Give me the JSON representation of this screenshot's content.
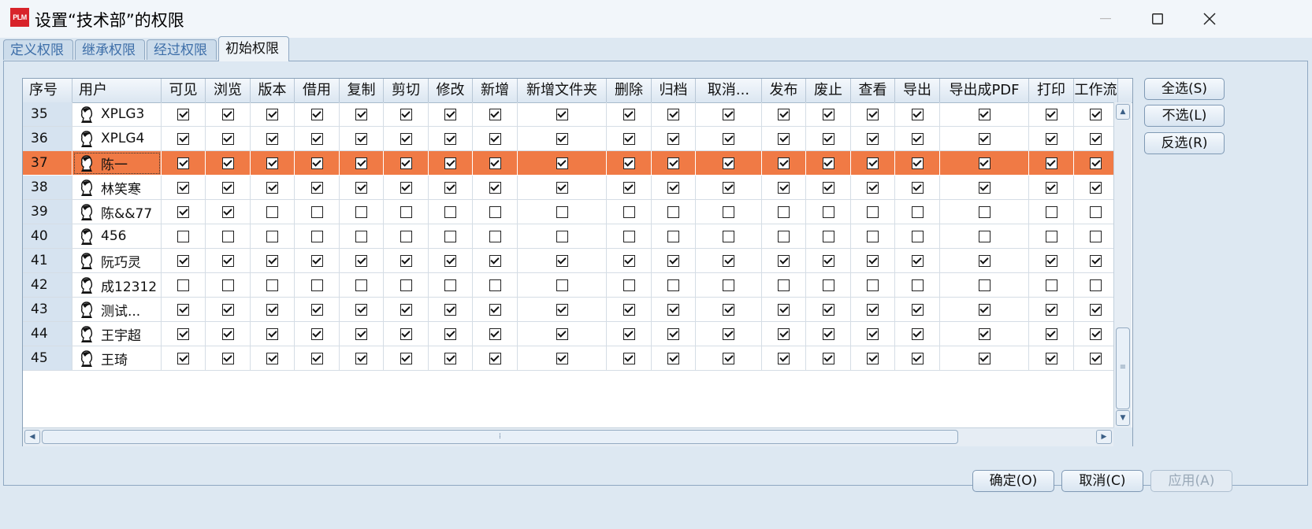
{
  "window": {
    "title": "设置“技术部”的权限",
    "logo_text": "PLM",
    "controls": [
      "minimize",
      "maximize",
      "close"
    ]
  },
  "tabs": [
    {
      "label": "定义权限",
      "active": false
    },
    {
      "label": "继承权限",
      "active": false
    },
    {
      "label": "经过权限",
      "active": false
    },
    {
      "label": "初始权限",
      "active": true
    }
  ],
  "columns": [
    "序号",
    "用户",
    "可见",
    "浏览",
    "版本",
    "借用",
    "复制",
    "剪切",
    "修改",
    "新增",
    "新增文件夹",
    "删除",
    "归档",
    "取消...",
    "发布",
    "废止",
    "查看",
    "导出",
    "导出成PDF",
    "打印",
    "工作流"
  ],
  "rows": [
    {
      "index": "35",
      "user": "XPLG3",
      "checks": [
        1,
        1,
        1,
        1,
        1,
        1,
        1,
        1,
        1,
        1,
        1,
        1,
        1,
        1,
        1,
        1,
        1,
        1,
        1
      ],
      "selected": false
    },
    {
      "index": "36",
      "user": "XPLG4",
      "checks": [
        1,
        1,
        1,
        1,
        1,
        1,
        1,
        1,
        1,
        1,
        1,
        1,
        1,
        1,
        1,
        1,
        1,
        1,
        1
      ],
      "selected": false
    },
    {
      "index": "37",
      "user": "陈一",
      "checks": [
        1,
        1,
        1,
        1,
        1,
        1,
        1,
        1,
        1,
        1,
        1,
        1,
        1,
        1,
        1,
        1,
        1,
        1,
        1
      ],
      "selected": true
    },
    {
      "index": "38",
      "user": "林笑寒",
      "checks": [
        1,
        1,
        1,
        1,
        1,
        1,
        1,
        1,
        1,
        1,
        1,
        1,
        1,
        1,
        1,
        1,
        1,
        1,
        1
      ],
      "selected": false
    },
    {
      "index": "39",
      "user": "陈&&77",
      "checks": [
        1,
        1,
        0,
        0,
        0,
        0,
        0,
        0,
        0,
        0,
        0,
        0,
        0,
        0,
        0,
        0,
        0,
        0,
        0
      ],
      "selected": false
    },
    {
      "index": "40",
      "user": "456",
      "checks": [
        0,
        0,
        0,
        0,
        0,
        0,
        0,
        0,
        0,
        0,
        0,
        0,
        0,
        0,
        0,
        0,
        0,
        0,
        0
      ],
      "selected": false
    },
    {
      "index": "41",
      "user": "阮巧灵",
      "checks": [
        1,
        1,
        1,
        1,
        1,
        1,
        1,
        1,
        1,
        1,
        1,
        1,
        1,
        1,
        1,
        1,
        1,
        1,
        1
      ],
      "selected": false
    },
    {
      "index": "42",
      "user": "成12312",
      "checks": [
        0,
        0,
        0,
        0,
        0,
        0,
        0,
        0,
        0,
        0,
        0,
        0,
        0,
        0,
        0,
        0,
        0,
        0,
        0
      ],
      "selected": false
    },
    {
      "index": "43",
      "user": "测试...",
      "checks": [
        1,
        1,
        1,
        1,
        1,
        1,
        1,
        1,
        1,
        1,
        1,
        1,
        1,
        1,
        1,
        1,
        1,
        1,
        1
      ],
      "selected": false
    },
    {
      "index": "44",
      "user": "王宇超",
      "checks": [
        1,
        1,
        1,
        1,
        1,
        1,
        1,
        1,
        1,
        1,
        1,
        1,
        1,
        1,
        1,
        1,
        1,
        1,
        1
      ],
      "selected": false
    },
    {
      "index": "45",
      "user": "王琦",
      "checks": [
        1,
        1,
        1,
        1,
        1,
        1,
        1,
        1,
        1,
        1,
        1,
        1,
        1,
        1,
        1,
        1,
        1,
        1,
        1
      ],
      "selected": false
    }
  ],
  "side_buttons": {
    "select_all": "全选(S)",
    "select_none": "不选(L)",
    "invert": "反选(R)"
  },
  "footer": {
    "ok": "确定(O)",
    "cancel": "取消(C)",
    "apply": "应用(A)"
  },
  "colors": {
    "selected_row": "#f07a45",
    "window_bg": "#dde8f2",
    "accent": "#3d6ea8"
  }
}
